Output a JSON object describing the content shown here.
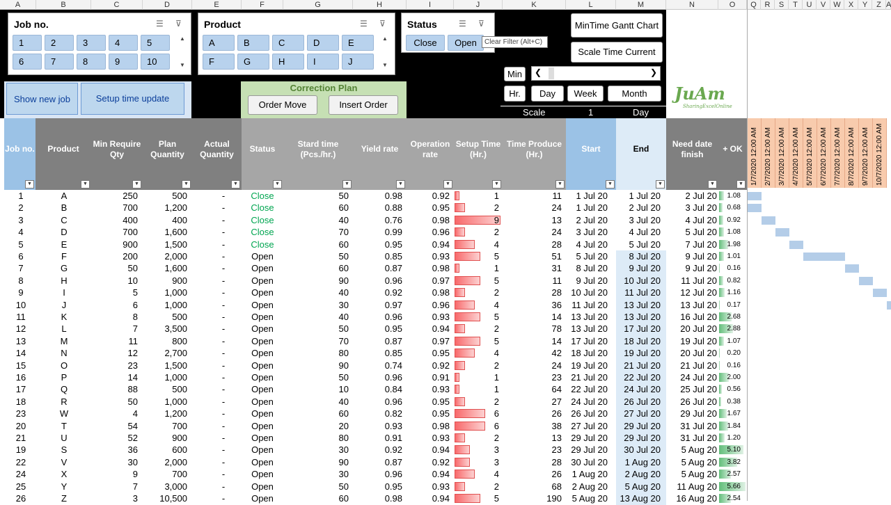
{
  "columns": [
    "A",
    "B",
    "C",
    "D",
    "E",
    "F",
    "G",
    "H",
    "I",
    "J",
    "K",
    "L",
    "M",
    "N",
    "O",
    "Q",
    "R",
    "S",
    "T",
    "U",
    "V",
    "W",
    "X",
    "Y",
    "Z",
    "A"
  ],
  "slicers": {
    "job": {
      "title": "Job no.",
      "items": [
        "1",
        "2",
        "3",
        "4",
        "5",
        "6",
        "7",
        "8",
        "9",
        "10"
      ]
    },
    "product": {
      "title": "Product",
      "items": [
        "A",
        "B",
        "C",
        "D",
        "E",
        "F",
        "G",
        "H",
        "I",
        "J"
      ]
    },
    "status": {
      "title": "Status",
      "items": [
        "Close",
        "Open"
      ]
    }
  },
  "tooltip": "Clear Filter (Alt+C)",
  "buttons": {
    "gantt": "MinTime Gantt Chart",
    "scale_current": "Scale Time Current",
    "show_new_job": "Show new job",
    "setup_time_update": "Setup time update",
    "correction_plan": "Correction Plan",
    "order_move": "Order Move",
    "insert_order": "Insert Order",
    "min": "Min",
    "hr": "Hr.",
    "day": "Day",
    "week": "Week",
    "month": "Month"
  },
  "scale": {
    "label": "Scale",
    "value": "1",
    "unit": "Day"
  },
  "logo": {
    "text": "JuAm",
    "sub": "SharingExcelOnline"
  },
  "headers": [
    "Job no.",
    "Product",
    "Min Require Qty",
    "Plan Quantity",
    "Actual Quantity",
    "Status",
    "Stard time (Pcs./hr.)",
    "Yield rate",
    "Operation rate",
    "Setup Time (Hr.)",
    "Time Produce (Hr.)",
    "Start",
    "End",
    "Need date finish",
    "+ OK"
  ],
  "gantt_dates": [
    "1/7/2020 12:00 AM",
    "2/7/2020 12:00 AM",
    "3/7/2020 12:00 AM",
    "4/7/2020 12:00 AM",
    "5/7/2020 12:00 AM",
    "6/7/2020 12:00 AM",
    "7/7/2020 12:00 AM",
    "8/7/2020 12:00 AM",
    "9/7/2020 12:00 AM",
    "10/7/2020 12:00 AM"
  ],
  "accent": {
    "status_close": "#00a550",
    "slicer_btn": "#b8d2ed",
    "gantt_block": "#b4cde8"
  },
  "rows": [
    [
      "1",
      "A",
      "250",
      "500",
      "-",
      "Close",
      "50",
      "0.98",
      "0.92",
      "1",
      "11",
      "1 Jul 20",
      "1 Jul 20",
      "2 Jul 20",
      "1.08"
    ],
    [
      "2",
      "B",
      "700",
      "1,200",
      "-",
      "Close",
      "60",
      "0.88",
      "0.95",
      "2",
      "24",
      "1 Jul 20",
      "2 Jul 20",
      "3 Jul 20",
      "0.68"
    ],
    [
      "3",
      "C",
      "400",
      "400",
      "-",
      "Close",
      "40",
      "0.76",
      "0.98",
      "9",
      "13",
      "2 Jul 20",
      "3 Jul 20",
      "4 Jul 20",
      "0.92"
    ],
    [
      "4",
      "D",
      "700",
      "1,600",
      "-",
      "Close",
      "70",
      "0.99",
      "0.96",
      "2",
      "24",
      "3 Jul 20",
      "4 Jul 20",
      "5 Jul 20",
      "1.08"
    ],
    [
      "5",
      "E",
      "900",
      "1,500",
      "-",
      "Close",
      "60",
      "0.95",
      "0.94",
      "4",
      "28",
      "4 Jul 20",
      "5 Jul 20",
      "7 Jul 20",
      "1.98"
    ],
    [
      "6",
      "F",
      "200",
      "2,000",
      "-",
      "Open",
      "50",
      "0.85",
      "0.93",
      "5",
      "51",
      "5 Jul 20",
      "8 Jul 20",
      "9 Jul 20",
      "1.01"
    ],
    [
      "7",
      "G",
      "50",
      "1,600",
      "-",
      "Open",
      "60",
      "0.87",
      "0.98",
      "1",
      "31",
      "8 Jul 20",
      "9 Jul 20",
      "9 Jul 20",
      "0.16"
    ],
    [
      "8",
      "H",
      "10",
      "900",
      "-",
      "Open",
      "90",
      "0.96",
      "0.97",
      "5",
      "11",
      "9 Jul 20",
      "10 Jul 20",
      "11 Jul 20",
      "0.82"
    ],
    [
      "9",
      "I",
      "5",
      "1,000",
      "-",
      "Open",
      "40",
      "0.92",
      "0.98",
      "2",
      "28",
      "10 Jul 20",
      "11 Jul 20",
      "12 Jul 20",
      "1.16"
    ],
    [
      "10",
      "J",
      "6",
      "1,000",
      "-",
      "Open",
      "30",
      "0.97",
      "0.96",
      "4",
      "36",
      "11 Jul 20",
      "13 Jul 20",
      "13 Jul 20",
      "0.17"
    ],
    [
      "11",
      "K",
      "8",
      "500",
      "-",
      "Open",
      "40",
      "0.96",
      "0.93",
      "5",
      "14",
      "13 Jul 20",
      "13 Jul 20",
      "16 Jul 20",
      "2.68"
    ],
    [
      "12",
      "L",
      "7",
      "3,500",
      "-",
      "Open",
      "50",
      "0.95",
      "0.94",
      "2",
      "78",
      "13 Jul 20",
      "17 Jul 20",
      "20 Jul 20",
      "2.88"
    ],
    [
      "13",
      "M",
      "11",
      "800",
      "-",
      "Open",
      "70",
      "0.87",
      "0.97",
      "5",
      "14",
      "17 Jul 20",
      "18 Jul 20",
      "19 Jul 20",
      "1.07"
    ],
    [
      "14",
      "N",
      "12",
      "2,700",
      "-",
      "Open",
      "80",
      "0.85",
      "0.95",
      "4",
      "42",
      "18 Jul 20",
      "19 Jul 20",
      "20 Jul 20",
      "0.20"
    ],
    [
      "15",
      "O",
      "23",
      "1,500",
      "-",
      "Open",
      "90",
      "0.74",
      "0.92",
      "2",
      "24",
      "19 Jul 20",
      "21 Jul 20",
      "21 Jul 20",
      "0.16"
    ],
    [
      "16",
      "P",
      "14",
      "1,000",
      "-",
      "Open",
      "50",
      "0.96",
      "0.91",
      "1",
      "23",
      "21 Jul 20",
      "22 Jul 20",
      "24 Jul 20",
      "2.00"
    ],
    [
      "17",
      "Q",
      "88",
      "500",
      "-",
      "Open",
      "10",
      "0.84",
      "0.93",
      "1",
      "64",
      "22 Jul 20",
      "24 Jul 20",
      "25 Jul 20",
      "0.56"
    ],
    [
      "18",
      "R",
      "50",
      "1,000",
      "-",
      "Open",
      "40",
      "0.96",
      "0.95",
      "2",
      "27",
      "24 Jul 20",
      "26 Jul 20",
      "26 Jul 20",
      "0.38"
    ],
    [
      "23",
      "W",
      "4",
      "1,200",
      "-",
      "Open",
      "60",
      "0.82",
      "0.95",
      "6",
      "26",
      "26 Jul 20",
      "27 Jul 20",
      "29 Jul 20",
      "1.67"
    ],
    [
      "20",
      "T",
      "54",
      "700",
      "-",
      "Open",
      "20",
      "0.93",
      "0.98",
      "6",
      "38",
      "27 Jul 20",
      "29 Jul 20",
      "31 Jul 20",
      "1.84"
    ],
    [
      "21",
      "U",
      "52",
      "900",
      "-",
      "Open",
      "80",
      "0.91",
      "0.93",
      "2",
      "13",
      "29 Jul 20",
      "29 Jul 20",
      "31 Jul 20",
      "1.20"
    ],
    [
      "19",
      "S",
      "36",
      "600",
      "-",
      "Open",
      "30",
      "0.92",
      "0.94",
      "3",
      "23",
      "29 Jul 20",
      "30 Jul 20",
      "5 Aug 20",
      "5.10"
    ],
    [
      "22",
      "V",
      "30",
      "2,000",
      "-",
      "Open",
      "90",
      "0.87",
      "0.92",
      "3",
      "28",
      "30 Jul 20",
      "1 Aug 20",
      "5 Aug 20",
      "3.82"
    ],
    [
      "24",
      "X",
      "9",
      "700",
      "-",
      "Open",
      "30",
      "0.96",
      "0.94",
      "4",
      "26",
      "1 Aug 20",
      "2 Aug 20",
      "5 Aug 20",
      "2.57"
    ],
    [
      "25",
      "Y",
      "7",
      "3,000",
      "-",
      "Open",
      "50",
      "0.95",
      "0.93",
      "2",
      "68",
      "2 Aug 20",
      "5 Aug 20",
      "11 Aug 20",
      "5.66"
    ],
    [
      "26",
      "Z",
      "3",
      "10,500",
      "-",
      "Open",
      "60",
      "0.98",
      "0.94",
      "5",
      "190",
      "5 Aug 20",
      "13 Aug 20",
      "16 Aug 20",
      "2.54"
    ]
  ]
}
